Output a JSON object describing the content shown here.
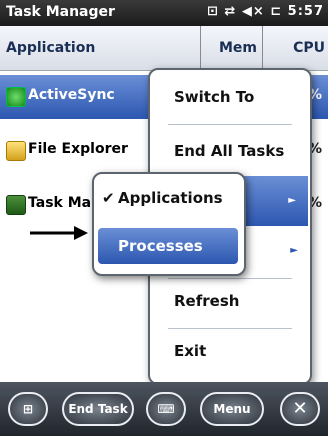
{
  "statusbar": {
    "title": "Task Manager",
    "icons_text": "⊡ ⇄ ◀× ⊏ 5:57"
  },
  "columns": {
    "application": "Application",
    "mem": "Mem",
    "cpu": "CPU"
  },
  "rows": [
    {
      "name": "ActiveSync",
      "cpu": "%",
      "selected": true
    },
    {
      "name": "File Explorer",
      "cpu": "%"
    },
    {
      "name": "Task Ma",
      "cpu": "%"
    }
  ],
  "menu": {
    "switch_to": "Switch To",
    "end_all": "End All Tasks",
    "refresh": "Refresh",
    "exit": "Exit",
    "submenu_arrow": "►"
  },
  "submenu": {
    "applications": "Applications",
    "processes": "Processes",
    "check": "✔"
  },
  "taskbar": {
    "end_task": "End Task",
    "menu": "Menu",
    "close": "✕"
  },
  "colors": {
    "highlight": "#2d57b0",
    "border": "#5c6470"
  }
}
